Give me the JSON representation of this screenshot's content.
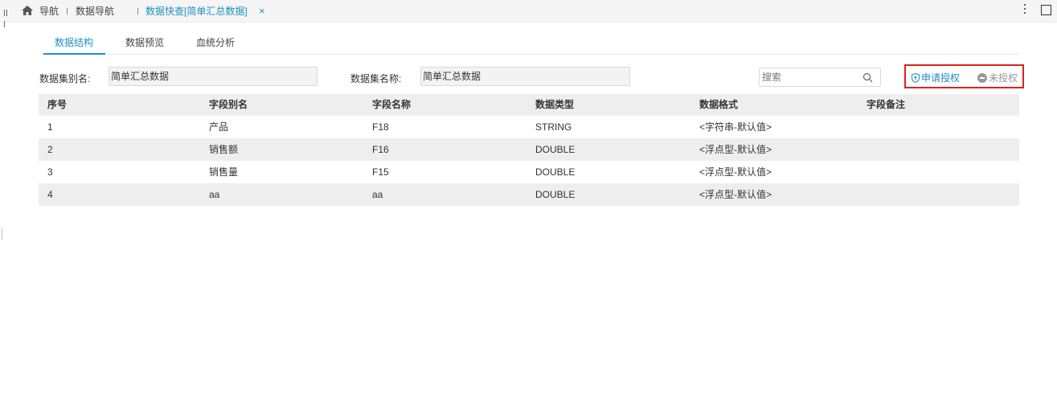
{
  "topbar": {
    "nav_label": "导航",
    "tabs": [
      {
        "label": "数据导航"
      },
      {
        "label": "数据快查[简单汇总数据]"
      }
    ],
    "close_glyph": "×"
  },
  "subtabs": [
    {
      "label": "数据结构"
    },
    {
      "label": "数据预览"
    },
    {
      "label": "血统分析"
    }
  ],
  "form": {
    "alias_label": "数据集别名:",
    "alias_value": "简单汇总数据",
    "name_label": "数据集名称:",
    "name_value": "简单汇总数据",
    "search_placeholder": "搜索"
  },
  "auth": {
    "apply_label": "申请授权",
    "status_label": "未授权"
  },
  "table": {
    "headers": [
      "序号",
      "字段别名",
      "字段名称",
      "数据类型",
      "数据格式",
      "字段备注"
    ],
    "rows": [
      [
        "1",
        "产品",
        "F18",
        "STRING",
        "<字符串-默认值>",
        ""
      ],
      [
        "2",
        "销售额",
        "F16",
        "DOUBLE",
        "<浮点型-默认值>",
        ""
      ],
      [
        "3",
        "销售量",
        "F15",
        "DOUBLE",
        "<浮点型-默认值>",
        ""
      ],
      [
        "4",
        "aa",
        "aa",
        "DOUBLE",
        "<浮点型-默认值>",
        ""
      ]
    ]
  },
  "colors": {
    "accent": "#1f8fc6",
    "highlight_border": "#e02020",
    "row_stripe": "#eeeeee"
  }
}
